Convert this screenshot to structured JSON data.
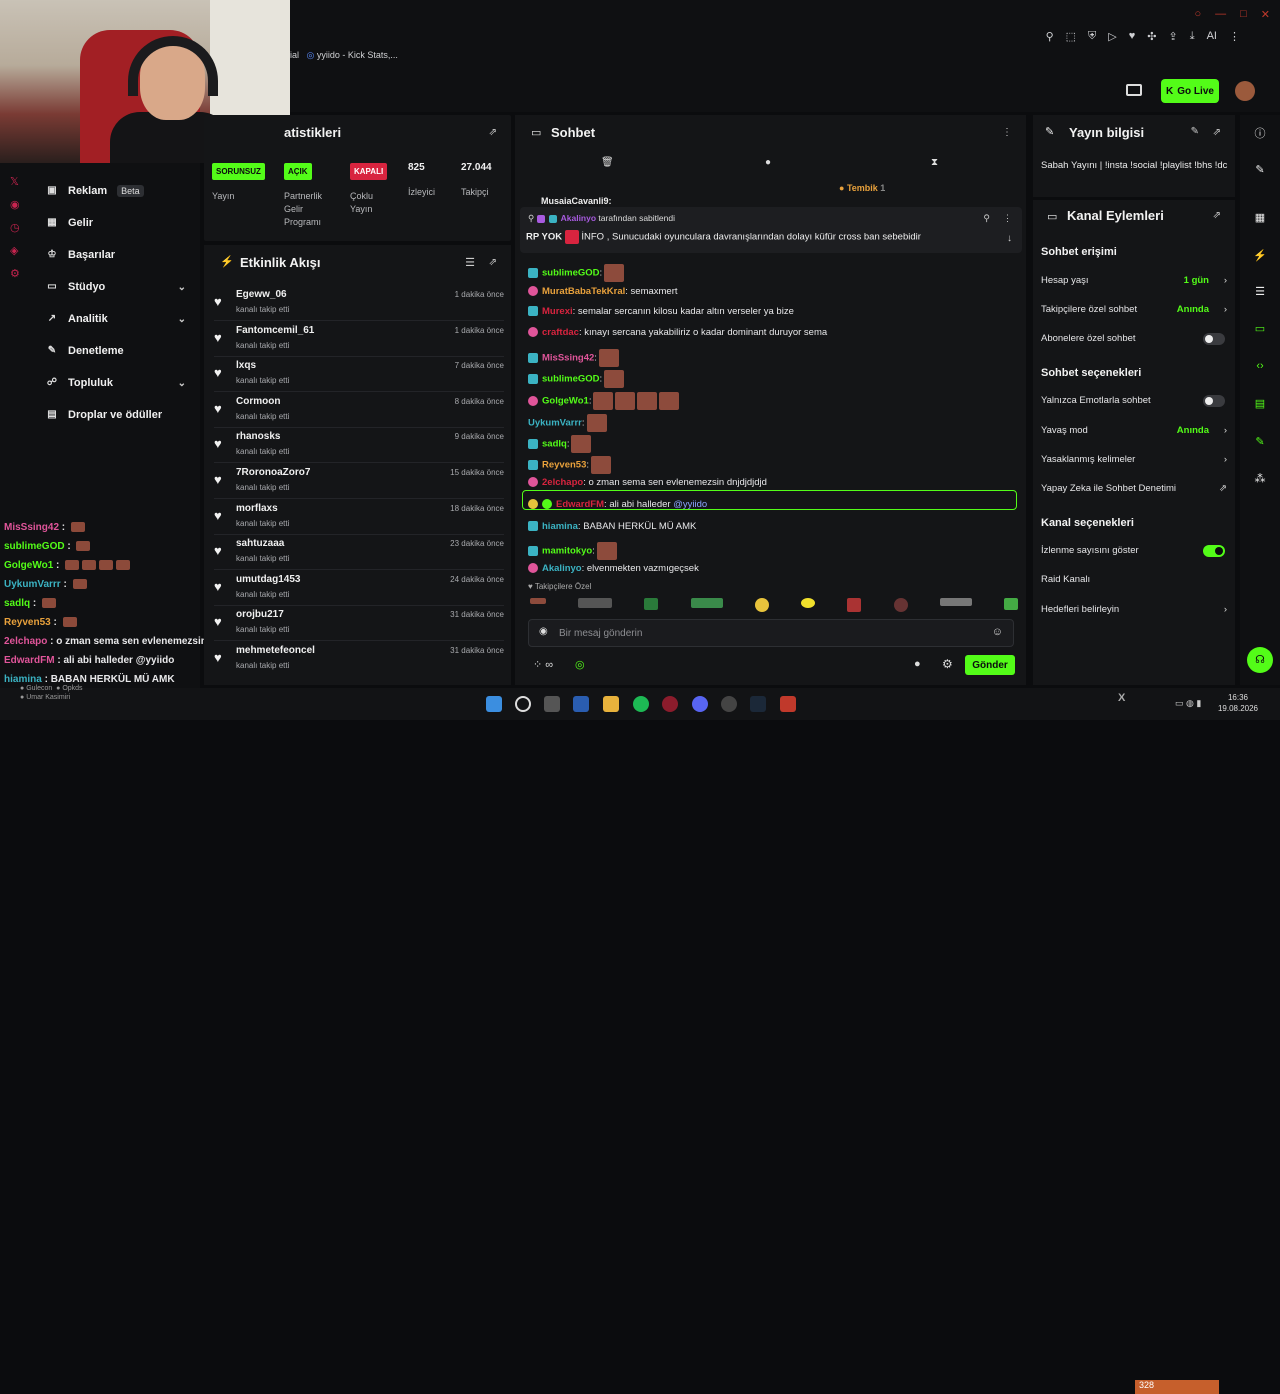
{
  "browser": {
    "tab_label": "yyiido - Kick Stats,...",
    "tab_prefix": "ial",
    "ai_label": "AI"
  },
  "header": {
    "go_live": "Go Live"
  },
  "nav": {
    "items": [
      {
        "label": "Reklam",
        "icon": "megaphone-icon",
        "beta": "Beta"
      },
      {
        "label": "Gelir",
        "icon": "calculator-icon"
      },
      {
        "label": "Başarılar",
        "icon": "trophy-icon"
      },
      {
        "label": "Stüdyo",
        "icon": "tv-icon"
      },
      {
        "label": "Analitik",
        "icon": "chart-icon"
      },
      {
        "label": "Denetleme",
        "icon": "wrench-icon"
      },
      {
        "label": "Topluluk",
        "icon": "people-icon"
      },
      {
        "label": "Droplar ve ödüller",
        "icon": "gift-icon"
      }
    ]
  },
  "overlay_chat": [
    {
      "user": "MisSsing42",
      "color": "#e0559a",
      "text": ""
    },
    {
      "user": "sublimeGOD",
      "color": "#53fc18",
      "text": ""
    },
    {
      "user": "GolgeWo1",
      "color": "#53fc18",
      "text": ""
    },
    {
      "user": "UykumVarrr",
      "color": "#3bb3c3",
      "text": ""
    },
    {
      "user": "sadlq",
      "color": "#53fc18",
      "text": ""
    },
    {
      "user": "Reyven53",
      "color": "#e8a13c",
      "text": ""
    },
    {
      "user": "2elchapo",
      "color": "#e0559a",
      "text": "o zman sema sen evlenemezsin dnj"
    },
    {
      "user": "EdwardFM",
      "color": "#e0559a",
      "text": "ali abi halleder @yyiido"
    },
    {
      "user": "hiamina",
      "color": "#3bb3c3",
      "text": "BABAN HERKÜL MÜ AMK"
    },
    {
      "user": "mamitokyo",
      "color": "#53fc18",
      "text": ""
    }
  ],
  "stats": {
    "title": "İstatistikleri",
    "title_visible": "atistikleri",
    "cols": [
      {
        "badge": "SORUNSUZ",
        "badge_color": "#53fc18",
        "label": "Yayın"
      },
      {
        "badge": "AÇIK",
        "badge_color": "#53fc18",
        "label": "Partnerlik Gelir Programı"
      },
      {
        "badge": "KAPALI",
        "badge_color": "#d8243f",
        "label": "Çoklu Yayın"
      },
      {
        "value": "825",
        "label": "İzleyici"
      },
      {
        "value": "27.044",
        "label": "Takipçi"
      }
    ]
  },
  "activity": {
    "title": "Etkinlik Akışı",
    "rows": [
      {
        "user": "Egeww_06",
        "action": "kanalı takip etti",
        "time": "1 dakika önce"
      },
      {
        "user": "Fantomcemil_61",
        "action": "kanalı takip etti",
        "time": "1 dakika önce"
      },
      {
        "user": "lxqs",
        "action": "kanalı takip etti",
        "time": "7 dakika önce"
      },
      {
        "user": "Cormoon",
        "action": "kanalı takip etti",
        "time": "8 dakika önce"
      },
      {
        "user": "rhanosks",
        "action": "kanalı takip etti",
        "time": "9 dakika önce"
      },
      {
        "user": "7RoronoaZoro7",
        "action": "kanalı takip etti",
        "time": "15 dakika önce"
      },
      {
        "user": "morflaxs",
        "action": "kanalı takip etti",
        "time": "18 dakika önce"
      },
      {
        "user": "sahtuzaaa",
        "action": "kanalı takip etti",
        "time": "23 dakika önce"
      },
      {
        "user": "umutdag1453",
        "action": "kanalı takip etti",
        "time": "24 dakika önce"
      },
      {
        "user": "orojbu217",
        "action": "kanalı takip etti",
        "time": "31 dakika önce"
      },
      {
        "user": "mehmetefeoncel",
        "action": "kanalı takip etti",
        "time": "31 dakika önce"
      }
    ]
  },
  "chat": {
    "title": "Sohbet",
    "tembik": "Tembik",
    "tembik_count": "1",
    "cut_user": "MusaiaCavanli9:",
    "pinned_by_user": "Akalinyo",
    "pinned_by_text": "tarafından sabitlendi",
    "pinned_text": "RP YOK",
    "pinned_msg": "İNFO , Sunucudaki oyunculara davranışlarından dolayı küfür cross ban sebebidir",
    "messages": [
      {
        "user": "sublimeGOD",
        "color": "#53fc18",
        "badge": "tw",
        "text": "",
        "emotes": 1
      },
      {
        "user": "MuratBabaTekKral",
        "color": "#e8a13c",
        "badge": "kk",
        "text": "semaxmert",
        "emotes": 0
      },
      {
        "user": "Murexi",
        "color": "#d8243f",
        "badge": "tw",
        "text": "semalar sercanın kilosu kadar altın verseler ya bize",
        "emotes": 0
      },
      {
        "user": "craftdac",
        "color": "#d8243f",
        "badge": "kk",
        "text": "kınayı sercana yakabiliriz o kadar dominant duruyor sema",
        "emotes": 0
      },
      {
        "user": "MisSsing42",
        "color": "#e0559a",
        "badge": "tw",
        "text": "",
        "emotes": 1
      },
      {
        "user": "sublimeGOD",
        "color": "#53fc18",
        "badge": "tw",
        "text": "",
        "emotes": 1
      },
      {
        "user": "GolgeWo1",
        "color": "#53fc18",
        "badge": "kk",
        "text": "",
        "emotes": 4
      },
      {
        "user": "UykumVarrr",
        "color": "#3bb3c3",
        "badge": "",
        "text": "",
        "emotes": 1
      },
      {
        "user": "sadlq",
        "color": "#53fc18",
        "badge": "tw",
        "text": "",
        "emotes": 1
      },
      {
        "user": "Reyven53",
        "color": "#e8a13c",
        "badge": "tw",
        "text": "",
        "emotes": 1
      },
      {
        "user": "2elchapo",
        "color": "#d8243f",
        "badge": "kk",
        "text": "o zman sema sen evlenemezsin dnjdjdjdjd",
        "emotes": 0
      },
      {
        "user": "EdwardFM",
        "color": "#d8243f",
        "badge": "kk",
        "text": "ali abi halleder",
        "mention": "@yyiido",
        "emotes": 0
      },
      {
        "user": "hiamina",
        "color": "#3bb3c3",
        "badge": "tw",
        "text": "BABAN HERKÜL MÜ AMK",
        "emotes": 0
      },
      {
        "user": "mamitokyo",
        "color": "#53fc18",
        "badge": "tw",
        "text": "",
        "emotes": 1
      },
      {
        "user": "Akalinyo",
        "color": "#3bb3c3",
        "badge": "kk",
        "text": "elvenmekten vazmıgeçsek",
        "emotes": 0
      }
    ],
    "followers_only": "Takipçilere Özel",
    "input_placeholder": "Bir mesaj gönderin",
    "send": "Gönder"
  },
  "stream_info": {
    "title": "Yayın bilgisi",
    "text": "Sabah Yayını | !insta !social !playlist !bhs !dc"
  },
  "channel_actions": {
    "title": "Kanal Eylemleri",
    "chat_access": "Sohbet erişimi",
    "account_age": "Hesap yaşı",
    "account_age_val": "1 gün",
    "followers_chat": "Takipçilere özel sohbet",
    "followers_chat_val": "Anında",
    "subs_chat": "Abonelere özel sohbet",
    "chat_options": "Sohbet seçenekleri",
    "emote_only": "Yalnızca Emotlarla sohbet",
    "slow_mode": "Yavaş mod",
    "slow_mode_val": "Anında",
    "banned_words": "Yasaklanmış kelimeler",
    "ai_moderation": "Yapay Zeka ile Sohbet Denetimi",
    "channel_options": "Kanal seçenekleri",
    "show_viewers": "İzlenme sayısını göster",
    "raid": "Raid Kanalı",
    "goals": "Hedefleri belirleyin"
  },
  "taskbar": {
    "viewers": "328",
    "time": "16:36",
    "date": "19.08.2026"
  },
  "overlay_users": [
    "Gulecon",
    "Opkds",
    "Umar Kasimiri"
  ]
}
